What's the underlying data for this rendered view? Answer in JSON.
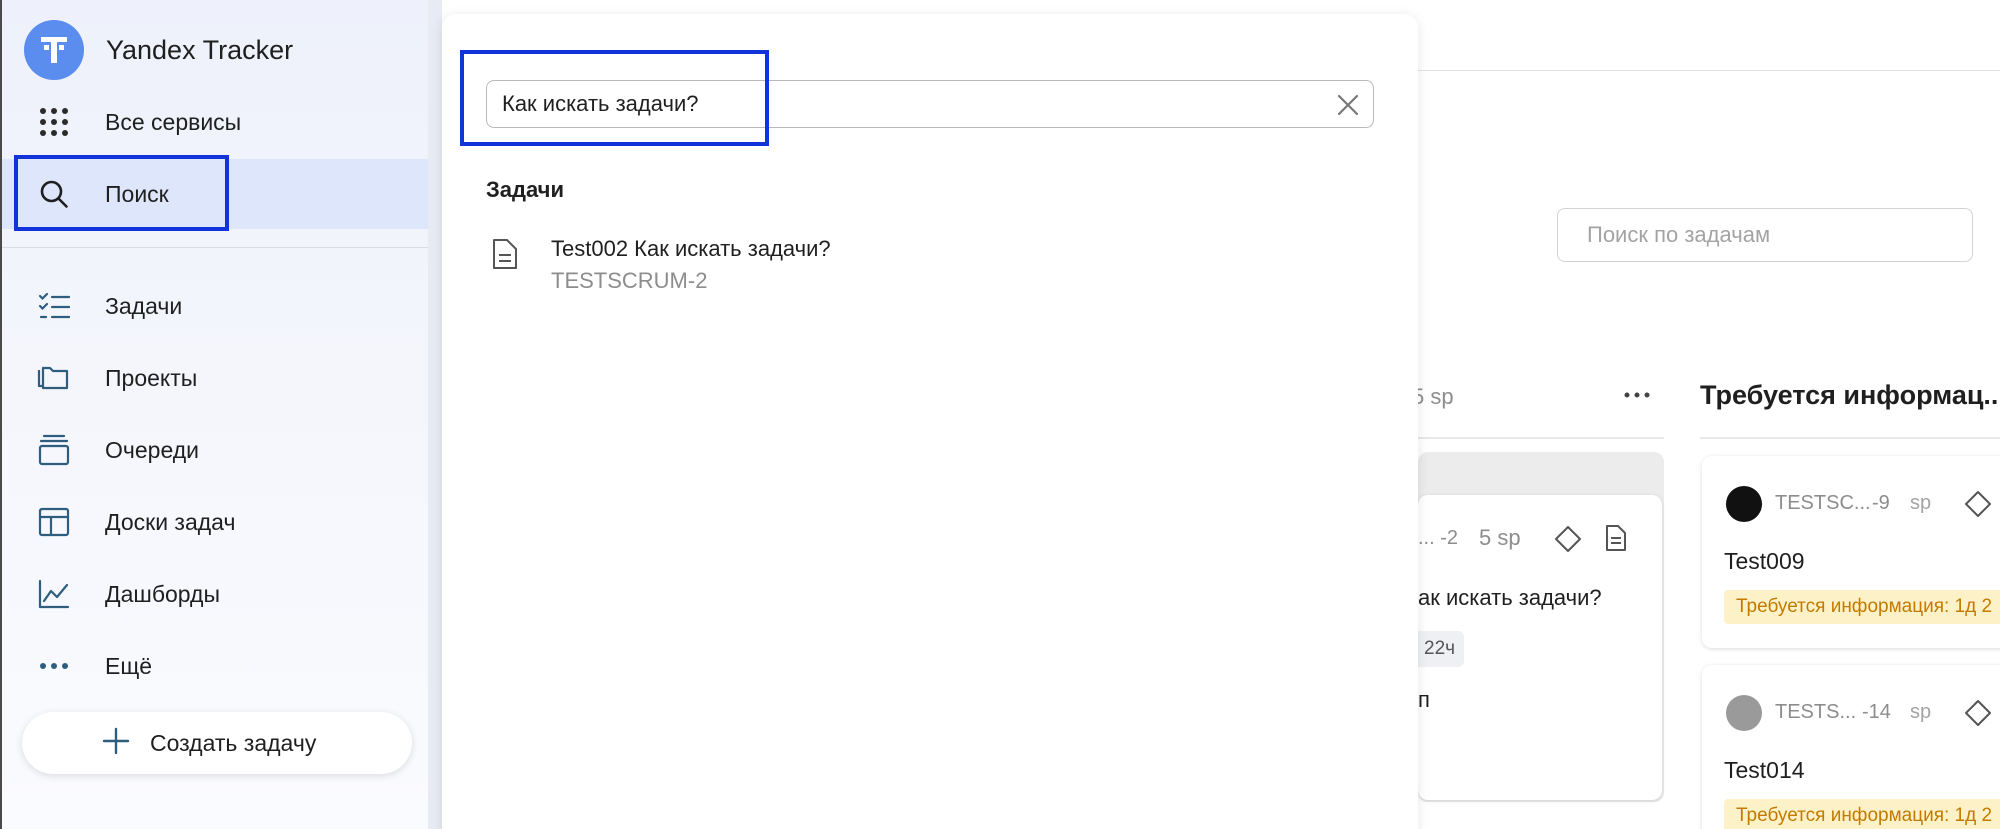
{
  "app": {
    "brand_name": "Yandex Tracker",
    "brand_icon": "tracker-logo",
    "brand_color": "#5b8def"
  },
  "sidebar": {
    "all_services": {
      "label": "Все сервисы",
      "icon": "grid-icon"
    },
    "search": {
      "label": "Поиск",
      "icon": "search-icon"
    },
    "items": [
      {
        "label": "Задачи",
        "icon": "tasks-icon"
      },
      {
        "label": "Проекты",
        "icon": "folders-icon"
      },
      {
        "label": "Очереди",
        "icon": "queues-icon"
      },
      {
        "label": "Доски задач",
        "icon": "board-icon"
      },
      {
        "label": "Дашборды",
        "icon": "chart-icon"
      },
      {
        "label": "Ещё",
        "icon": "more-icon"
      }
    ],
    "create_button": "Создать задачу"
  },
  "search_panel": {
    "query": "Как искать задачи?",
    "results_heading": "Задачи",
    "results": [
      {
        "title": "Test002 Как искать задачи?",
        "key": "TESTSCRUM-2"
      }
    ]
  },
  "board": {
    "search_placeholder": "Поиск по задачам",
    "column1": {
      "sp_total": "5 sp",
      "card": {
        "key_fragment": "... -2",
        "sp": "5 sp",
        "title_fragment": "ак искать задачи?",
        "badge_fragment": "22ч",
        "extra_fragment": "п"
      }
    },
    "column2": {
      "title": "Требуется информац...",
      "cards": [
        {
          "key": "TESTSC...",
          "number": "-9",
          "sp": "sp",
          "title": "Test009",
          "badge": "Требуется информация: 1д 2"
        },
        {
          "key": "TESTS...",
          "number": "-14",
          "sp": "sp",
          "title": "Test014",
          "badge": "Требуется информация: 1д 2"
        }
      ]
    }
  },
  "highlight_color": "#1034d9"
}
